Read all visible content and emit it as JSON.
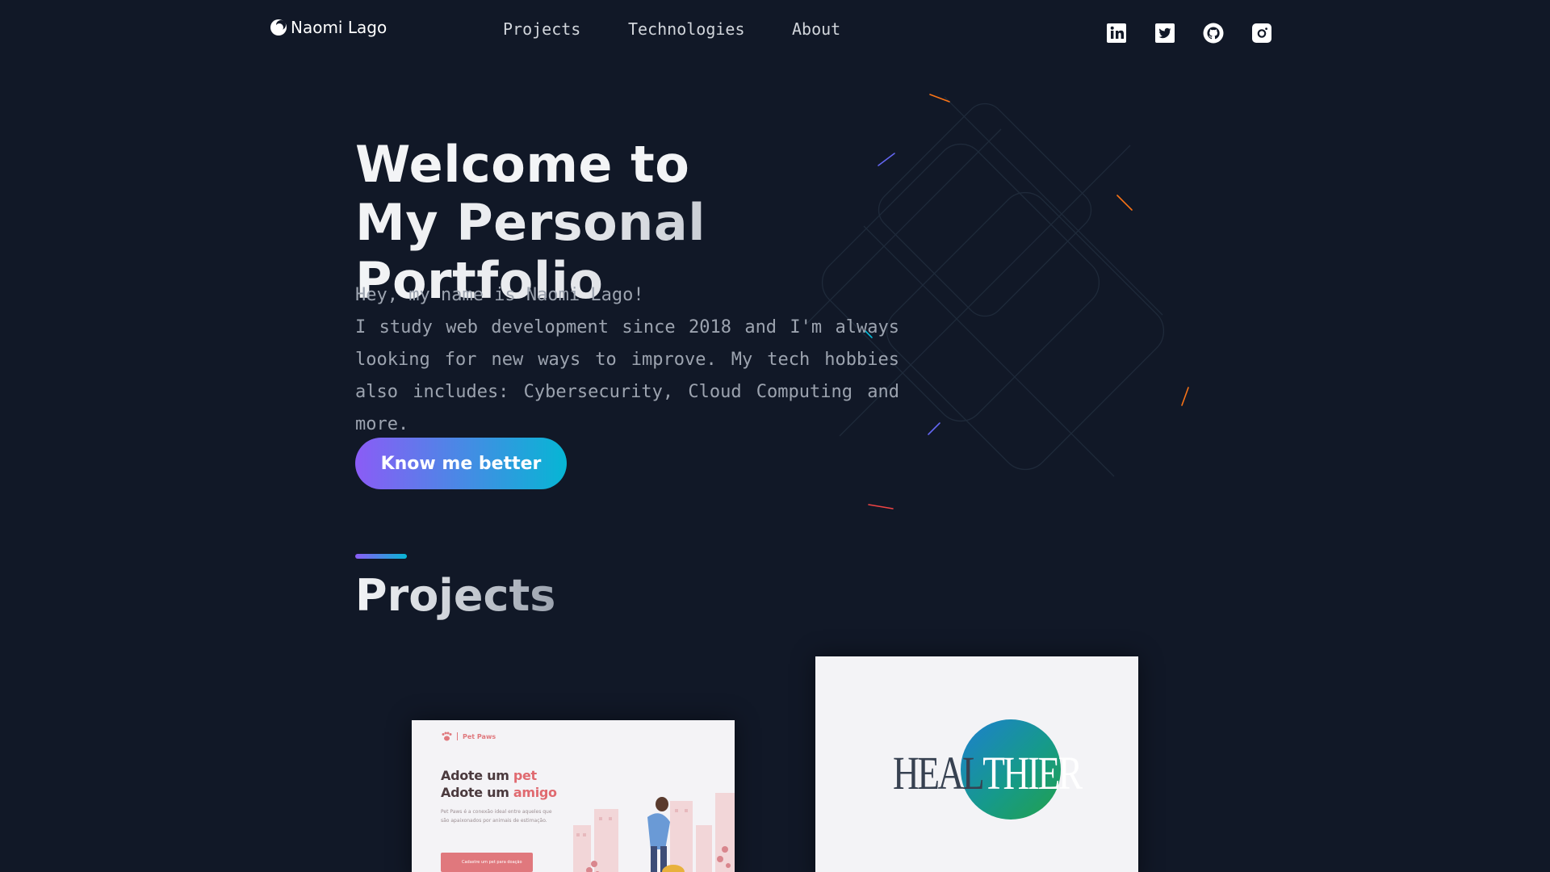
{
  "header": {
    "logo_text": "Naomi Lago",
    "nav": [
      {
        "label": "Projects"
      },
      {
        "label": "Technologies"
      },
      {
        "label": "About"
      }
    ],
    "social_icons": [
      "linkedin-icon",
      "twitter-icon",
      "github-icon",
      "instagram-icon"
    ]
  },
  "hero": {
    "title_line1": "Welcome to",
    "title_line2": "My Personal Portfolio",
    "greeting": "Hey, my name is Naomi Lago!",
    "description": "I study web development since 2018 and I'm always looking for new ways to improve. My tech hobbies also includes: Cybersecurity, Cloud Computing and more.",
    "cta_label": "Know me better"
  },
  "projects": {
    "section_title": "Projects",
    "cards": [
      {
        "brand": "Pet Paws",
        "headline_1a": "Adote um ",
        "headline_1b": "pet",
        "headline_2a": "Adote um ",
        "headline_2b": "amigo",
        "text": "Pet Paws é a conexão ideal entre aqueles que são apaixonados por animais de estimação.",
        "button": "Cadastre um pet para doação"
      },
      {
        "logo_part1": "HEAL",
        "logo_part2": "THIER"
      }
    ]
  },
  "colors": {
    "background": "#111827",
    "accent_purple": "#8b5cf6",
    "accent_cyan": "#06b6d4"
  }
}
